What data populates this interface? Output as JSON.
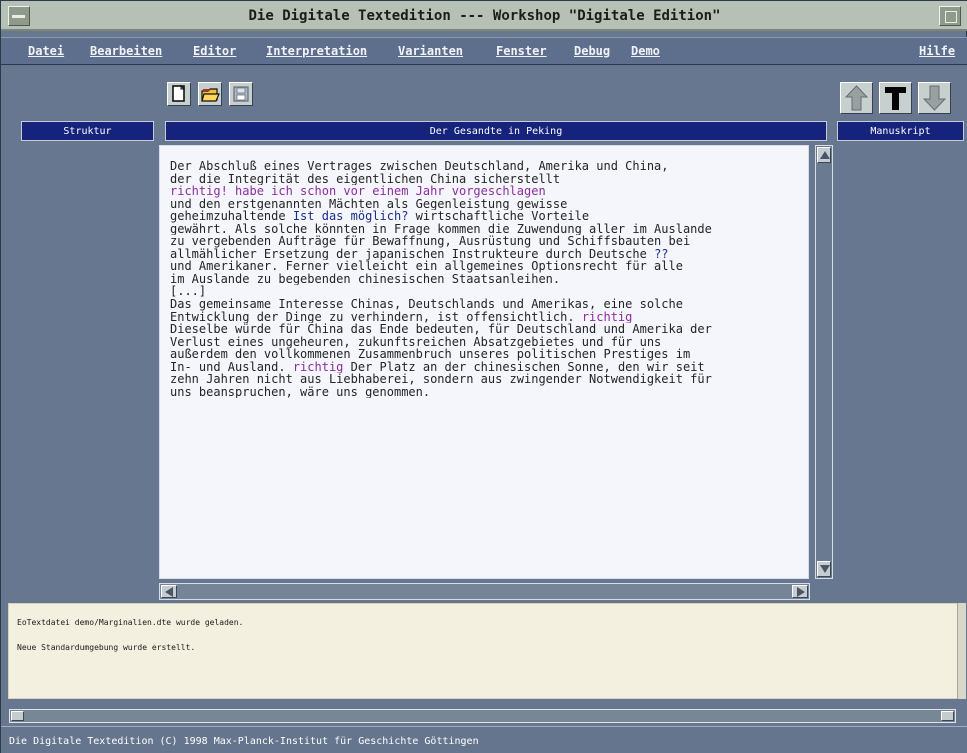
{
  "window": {
    "title": "Die Digitale Textedition --- Workshop \"Digitale Edition\""
  },
  "menu": {
    "items": [
      "Datei",
      "Bearbeiten",
      "Editor",
      "Interpretation",
      "Varianten",
      "Fenster",
      "Debug",
      "Demo"
    ],
    "help": "Hilfe"
  },
  "toolbar": {
    "buttons": [
      "new-document-icon",
      "open-folder-icon",
      "save-disk-icon"
    ],
    "nav_buttons": [
      "arrow-up-icon",
      "text-t-icon",
      "arrow-down-icon"
    ],
    "nav_text_label": "T"
  },
  "panels": {
    "structure": "Struktur",
    "document": "Der Gesandte in Peking",
    "manuscript": "Manuskript"
  },
  "document": {
    "lines": [
      [
        {
          "text": "Der Abschluß eines Vertrages zwischen Deutschland, Amerika und China,",
          "style": "normal"
        }
      ],
      [
        {
          "text": "der die Integrität des eigentlichen China sicherstellt",
          "style": "normal"
        }
      ],
      [
        {
          "text": "richtig! habe ich schon vor einem Jahr vorgeschlagen",
          "style": "annotation"
        }
      ],
      [
        {
          "text": "und den erstgenannten Mächten als Gegenleistung gewisse",
          "style": "normal"
        }
      ],
      [
        {
          "text": "geheimzuhaltende ",
          "style": "normal"
        },
        {
          "text": "Ist das möglich?",
          "style": "question"
        },
        {
          "text": " wirtschaftliche Vorteile",
          "style": "normal"
        }
      ],
      [
        {
          "text": "gewährt. Als solche könnten in Frage kommen die Zuwendung aller im Auslande",
          "style": "normal"
        }
      ],
      [
        {
          "text": "zu vergebenden Aufträge für Bewaffnung, Ausrüstung und Schiffsbauten bei",
          "style": "normal"
        }
      ],
      [
        {
          "text": "allmählicher Ersetzung der japanischen Instrukteure durch Deutsche ",
          "style": "normal"
        },
        {
          "text": "??",
          "style": "question"
        }
      ],
      [
        {
          "text": "und Amerikaner. Ferner vielleicht ein allgemeines Optionsrecht für alle",
          "style": "normal"
        }
      ],
      [
        {
          "text": "im Auslande zu begebenden chinesischen Staatsanleihen.",
          "style": "normal"
        }
      ],
      [
        {
          "text": "[...]",
          "style": "ellipsis"
        }
      ],
      [
        {
          "text": "Das gemeinsame Interesse Chinas, Deutschlands und Amerikas, eine solche",
          "style": "normal"
        }
      ],
      [
        {
          "text": "Entwicklung der Dinge zu verhindern, ist offensichtlich. ",
          "style": "normal"
        },
        {
          "text": "richtig",
          "style": "annotation"
        }
      ],
      [
        {
          "text": "Dieselbe würde für China das Ende bedeuten, für Deutschland und Amerika der",
          "style": "normal"
        }
      ],
      [
        {
          "text": "Verlust eines ungeheuren, zukunftsreichen Absatzgebietes und für uns",
          "style": "normal"
        }
      ],
      [
        {
          "text": "außerdem den vollkommenen Zusammenbruch unseres politischen Prestiges im",
          "style": "normal"
        }
      ],
      [
        {
          "text": "In- und Ausland. ",
          "style": "normal"
        },
        {
          "text": "richtig",
          "style": "annotation"
        },
        {
          "text": " Der Platz an der chinesischen Sonne, den wir seit",
          "style": "normal"
        }
      ],
      [
        {
          "text": "zehn Jahren nicht aus Liebhaberei, sondern aus zwingender Notwendigkeit für",
          "style": "normal"
        }
      ],
      [
        {
          "text": "uns beanspruchen, wäre uns genommen.",
          "style": "normal"
        }
      ]
    ]
  },
  "console": {
    "lines": [
      "EoTextdatei demo/Marginalien.dte wurde geladen.",
      "Neue Standardumgebung wurde erstellt."
    ]
  },
  "status": {
    "text": "Die Digitale Textedition (C) 1998 Max-Planck-Institut für Geschichte Göttingen"
  },
  "colors": {
    "window": "#67788f",
    "title_bar": "#b7c0b4",
    "panel_header": "#15237d",
    "document_background": "#f5f6fb",
    "annotation": "#8b2d9f",
    "question": "#1b2d8f",
    "console_background": "#f3f0df"
  }
}
